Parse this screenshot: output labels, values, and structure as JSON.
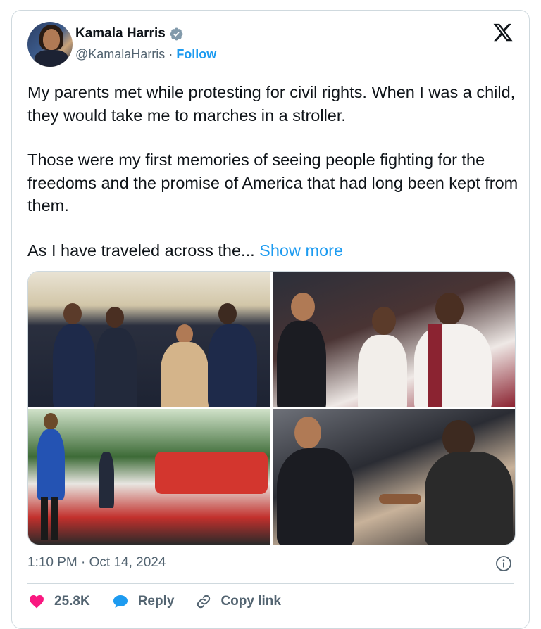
{
  "author": {
    "name": "Kamala Harris",
    "handle": "@KamalaHarris",
    "separator": " · ",
    "follow_label": "Follow"
  },
  "tweet": {
    "paragraphs": [
      "My parents met while protesting for civil rights. When I was a child, they would take me to marches in a stroller.",
      "Those were my first memories of seeing people fighting for the freedoms and the promise of America that had long been kept from them."
    ],
    "truncated_line": "As I have traveled across the... ",
    "show_more_label": "Show more"
  },
  "timestamp": "1:10 PM · Oct 14, 2024",
  "actions": {
    "likes": "25.8K",
    "reply_label": "Reply",
    "copy_label": "Copy link"
  },
  "colors": {
    "accent": "#1d9bf0",
    "like": "#f91880",
    "secondary_text": "#536471"
  },
  "icons": {
    "verified": "verified-badge-icon",
    "platform": "x-logo-icon",
    "info": "info-icon",
    "like": "heart-icon",
    "reply": "speech-bubble-icon",
    "copy": "link-icon"
  }
}
